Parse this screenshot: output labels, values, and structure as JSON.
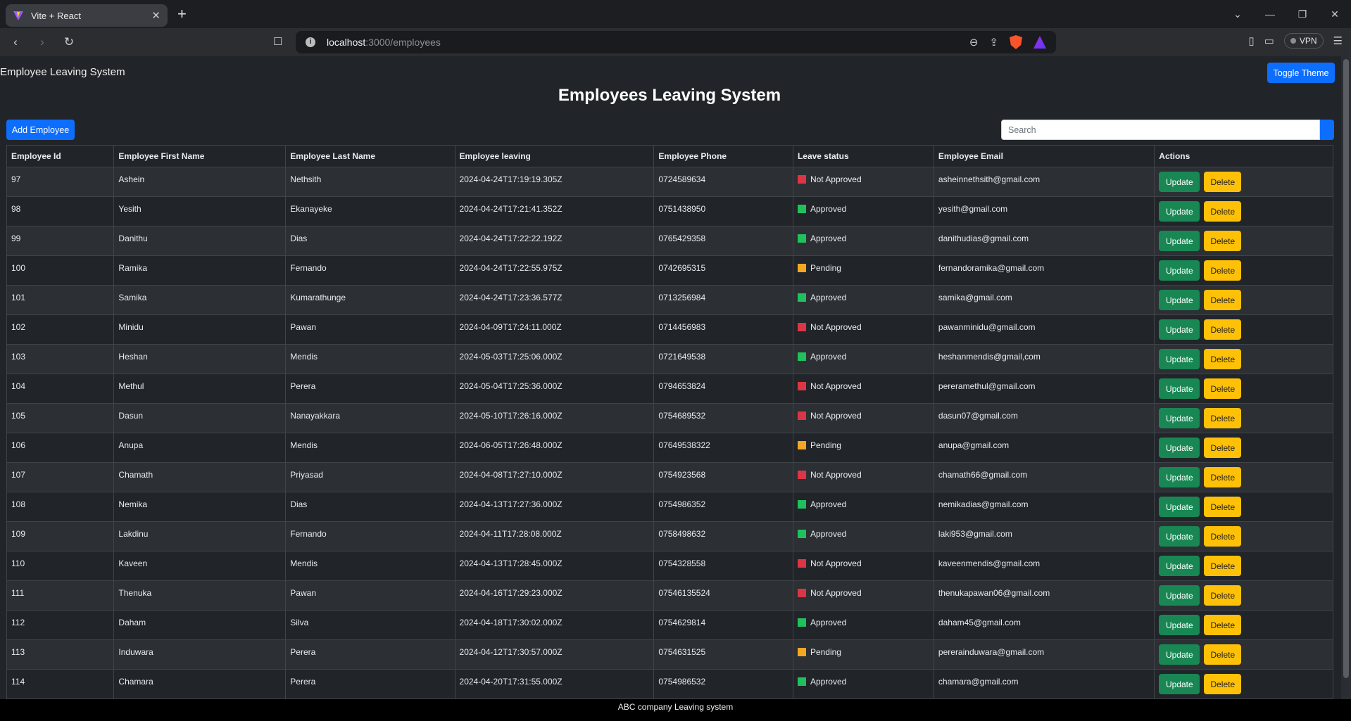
{
  "browser": {
    "tab_title": "Vite + React",
    "url_host": "localhost",
    "url_path": ":3000/employees",
    "vpn_label": "VPN"
  },
  "app": {
    "brand": "Employee Leaving System",
    "toggle_label": "Toggle Theme",
    "heading": "Employees Leaving System",
    "add_label": "Add Employee",
    "search_placeholder": "Search",
    "footer": "ABC company Leaving system"
  },
  "table": {
    "headers": [
      "Employee Id",
      "Employee First Name",
      "Employee Last Name",
      "Employee leaving",
      "Employee Phone",
      "Leave status",
      "Employee Email",
      "Actions"
    ],
    "update_label": "Update",
    "delete_label": "Delete",
    "status_colors": {
      "Not Approved": "#dc3545",
      "Approved": "#20c05c",
      "Pending": "#f5a623"
    },
    "rows": [
      [
        "97",
        "Ashein",
        "Nethsith",
        "2024-04-24T17:19:19.305Z",
        "0724589634",
        "Not Approved",
        "asheinnethsith@gmail.com"
      ],
      [
        "98",
        "Yesith",
        "Ekanayeke",
        "2024-04-24T17:21:41.352Z",
        "0751438950",
        "Approved",
        "yesith@gmail.com"
      ],
      [
        "99",
        "Danithu",
        "Dias",
        "2024-04-24T17:22:22.192Z",
        "0765429358",
        "Approved",
        "danithudias@gmail.com"
      ],
      [
        "100",
        "Ramika",
        "Fernando",
        "2024-04-24T17:22:55.975Z",
        "0742695315",
        "Pending",
        "fernandoramika@gmail.com"
      ],
      [
        "101",
        "Samika",
        "Kumarathunge",
        "2024-04-24T17:23:36.577Z",
        "0713256984",
        "Approved",
        "samika@gmail.com"
      ],
      [
        "102",
        "Minidu",
        "Pawan",
        "2024-04-09T17:24:11.000Z",
        "0714456983",
        "Not Approved",
        "pawanminidu@gmail.com"
      ],
      [
        "103",
        "Heshan",
        "Mendis",
        "2024-05-03T17:25:06.000Z",
        "0721649538",
        "Approved",
        "heshanmendis@gmail,com"
      ],
      [
        "104",
        "Methul",
        "Perera",
        "2024-05-04T17:25:36.000Z",
        "0794653824",
        "Not Approved",
        "pereramethul@gmail.com"
      ],
      [
        "105",
        "Dasun",
        "Nanayakkara",
        "2024-05-10T17:26:16.000Z",
        "0754689532",
        "Not Approved",
        "dasun07@gmail.com"
      ],
      [
        "106",
        "Anupa",
        "Mendis",
        "2024-06-05T17:26:48.000Z",
        "07649538322",
        "Pending",
        "anupa@gmail.com"
      ],
      [
        "107",
        "Chamath",
        "Priyasad",
        "2024-04-08T17:27:10.000Z",
        "0754923568",
        "Not Approved",
        "chamath66@gmail.com"
      ],
      [
        "108",
        "Nemika",
        "Dias",
        "2024-04-13T17:27:36.000Z",
        "0754986352",
        "Approved",
        "nemikadias@gmail.com"
      ],
      [
        "109",
        "Lakdinu",
        "Fernando",
        "2024-04-11T17:28:08.000Z",
        "0758498632",
        "Approved",
        "laki953@gmail.com"
      ],
      [
        "110",
        "Kaveen",
        "Mendis",
        "2024-04-13T17:28:45.000Z",
        "0754328558",
        "Not Approved",
        "kaveenmendis@gmail.com"
      ],
      [
        "111",
        "Thenuka",
        "Pawan",
        "2024-04-16T17:29:23.000Z",
        "07546135524",
        "Not Approved",
        "thenukapawan06@gmail.com"
      ],
      [
        "112",
        "Daham",
        "Silva",
        "2024-04-18T17:30:02.000Z",
        "0754629814",
        "Approved",
        "daham45@gmail.com"
      ],
      [
        "113",
        "Induwara",
        "Perera",
        "2024-04-12T17:30:57.000Z",
        "0754631525",
        "Pending",
        "pererainduwara@gmail.com"
      ],
      [
        "114",
        "Chamara",
        "Perera",
        "2024-04-20T17:31:55.000Z",
        "0754986532",
        "Approved",
        "chamara@gmail.com"
      ]
    ]
  }
}
